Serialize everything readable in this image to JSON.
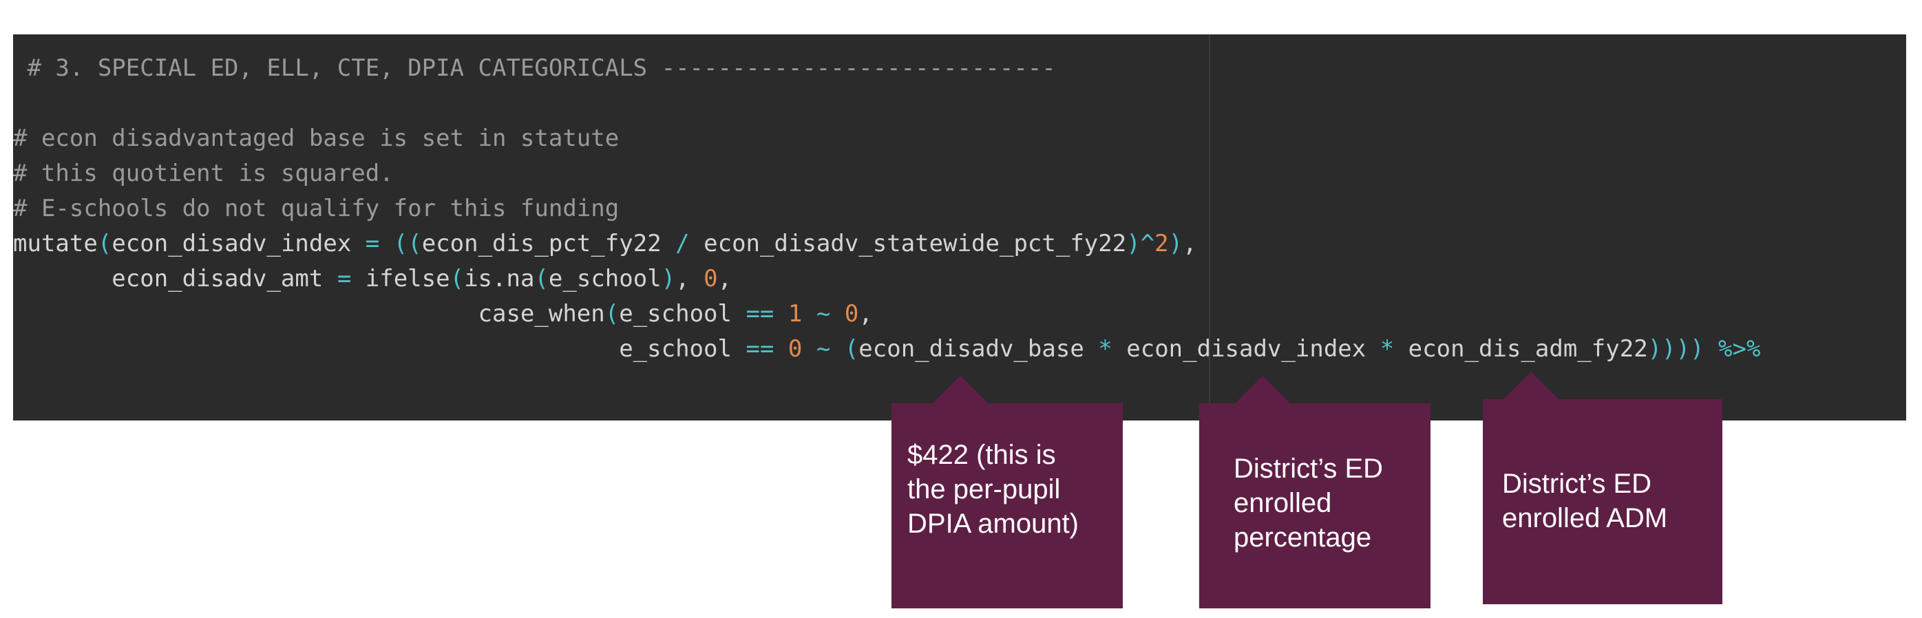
{
  "code": {
    "line1": [
      {
        "t": " # 3. SPECIAL ED, ELL, CTE, DPIA CATEGORICALS ----------------------------",
        "c": "cm"
      }
    ],
    "line3": [
      {
        "t": "# econ disadvantaged base is set in statute",
        "c": "cm"
      }
    ],
    "line4": [
      {
        "t": "# this quotient is squared.",
        "c": "cm"
      }
    ],
    "line5": [
      {
        "t": "# E-schools do not qualify for this funding",
        "c": "cm"
      }
    ],
    "line6": [
      {
        "t": "mutate",
        "c": "pl"
      },
      {
        "t": "(",
        "c": "op"
      },
      {
        "t": "econ_disadv_index ",
        "c": "pl"
      },
      {
        "t": "=",
        "c": "op"
      },
      {
        "t": " ",
        "c": "pl"
      },
      {
        "t": "((",
        "c": "op"
      },
      {
        "t": "econ_dis_pct_fy22 ",
        "c": "pl"
      },
      {
        "t": "/",
        "c": "op"
      },
      {
        "t": " econ_disadv_statewide_pct_fy22",
        "c": "pl"
      },
      {
        "t": ")^",
        "c": "op"
      },
      {
        "t": "2",
        "c": "num"
      },
      {
        "t": ")",
        "c": "op"
      },
      {
        "t": ",",
        "c": "pl"
      }
    ],
    "line7": [
      {
        "t": "       econ_disadv_amt ",
        "c": "pl"
      },
      {
        "t": "=",
        "c": "op"
      },
      {
        "t": " ifelse",
        "c": "pl"
      },
      {
        "t": "(",
        "c": "op"
      },
      {
        "t": "is.na",
        "c": "pl"
      },
      {
        "t": "(",
        "c": "op"
      },
      {
        "t": "e_school",
        "c": "pl"
      },
      {
        "t": ")",
        "c": "op"
      },
      {
        "t": ", ",
        "c": "pl"
      },
      {
        "t": "0",
        "c": "num"
      },
      {
        "t": ",",
        "c": "pl"
      }
    ],
    "line8": [
      {
        "t": "                                 case_when",
        "c": "pl"
      },
      {
        "t": "(",
        "c": "op"
      },
      {
        "t": "e_school ",
        "c": "pl"
      },
      {
        "t": "==",
        "c": "op"
      },
      {
        "t": " ",
        "c": "pl"
      },
      {
        "t": "1",
        "c": "num"
      },
      {
        "t": " ",
        "c": "pl"
      },
      {
        "t": "~",
        "c": "op"
      },
      {
        "t": " ",
        "c": "pl"
      },
      {
        "t": "0",
        "c": "num"
      },
      {
        "t": ",",
        "c": "pl"
      }
    ],
    "line9": [
      {
        "t": "                                           e_school ",
        "c": "pl"
      },
      {
        "t": "==",
        "c": "op"
      },
      {
        "t": " ",
        "c": "pl"
      },
      {
        "t": "0",
        "c": "num"
      },
      {
        "t": " ",
        "c": "pl"
      },
      {
        "t": "~",
        "c": "op"
      },
      {
        "t": " ",
        "c": "pl"
      },
      {
        "t": "(",
        "c": "op"
      },
      {
        "t": "econ_disadv_base ",
        "c": "pl"
      },
      {
        "t": "*",
        "c": "op"
      },
      {
        "t": " econ_disadv_index ",
        "c": "pl"
      },
      {
        "t": "*",
        "c": "op"
      },
      {
        "t": " econ_dis_adm_fy22",
        "c": "pl"
      },
      {
        "t": ")))) %>%",
        "c": "op"
      }
    ]
  },
  "callouts": {
    "base": "$422 (this is\nthe per-pupil\nDPIA amount)",
    "index": "District’s ED\nenrolled\npercentage",
    "adm": "District’s ED\nenrolled ADM"
  },
  "colors": {
    "editor_bg": "#2b2b2b",
    "comment": "#9a9a9a",
    "operator": "#4fc1c9",
    "number": "#e58a4c",
    "callout_bg": "#5e1f44"
  }
}
